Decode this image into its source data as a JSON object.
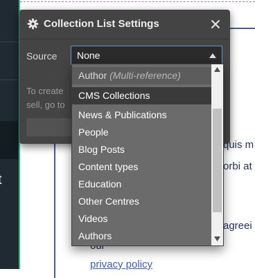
{
  "panel": {
    "title": "Collection List Settings",
    "source_label": "Source",
    "source_value": "None",
    "help_text": "To create sell, go to"
  },
  "dropdown": {
    "items": [
      {
        "label": "Author",
        "note": "(Multi-reference)",
        "state": "disabled"
      },
      {
        "label": "CMS Collections",
        "state": "highlighted"
      },
      {
        "label": "News & Publications"
      },
      {
        "label": "People"
      },
      {
        "label": "Blog Posts"
      },
      {
        "label": "Content types"
      },
      {
        "label": "Education"
      },
      {
        "label": "Other Centres"
      },
      {
        "label": "Videos"
      },
      {
        "label": "Authors"
      }
    ]
  },
  "background": {
    "heading_fragment": "r",
    "line1": "quis m",
    "line2": "orbi at",
    "line3": "agreei",
    "line4": "our",
    "link": "privacy policy",
    "rail_letter": "t"
  },
  "colors": {
    "panel_bg": "#444444",
    "select_border": "#5b9bd5",
    "canvas_selection": "#27c07b",
    "dropdown_bg": "#6b6b6b",
    "dropdown_highlight": "#3a3a3a"
  }
}
